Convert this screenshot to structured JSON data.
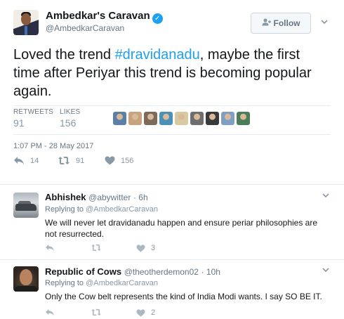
{
  "main_tweet": {
    "display_name": "Ambedkar's Caravan",
    "handle": "@AmbedkarCaravan",
    "follow_label": "Follow",
    "text_before": "Loved the trend ",
    "hashtag": "#dravidanadu",
    "text_after": ", maybe the first time after Periyar this trend is becoming popular again.",
    "retweets_label": "RETWEETS",
    "retweets_count": "91",
    "likes_label": "LIKES",
    "likes_count": "156",
    "timestamp": "1:07 PM - 28 May 2017",
    "actions": {
      "replies": "14",
      "retweets": "91",
      "likes": "156"
    },
    "liker_avatar_colors": [
      "#5b7fa6",
      "#c9a27e",
      "#7c6b5a",
      "#4a90b8",
      "#d8c9a0",
      "#6e6e6e",
      "#3a3a3a",
      "#7fa0c4",
      "#4c7d5a"
    ]
  },
  "replies": [
    {
      "display_name": "Abhishek",
      "handle": "@abywitter",
      "time": "· 6h",
      "replying_to_label": "Replying to",
      "replying_to": "@AmbedkarCaravan",
      "text": "We will never let dravidanadu happen and ensure periar philosophies are not resurrected.",
      "likes": "3"
    },
    {
      "display_name": "Republic of Cows",
      "handle": "@theotherdemon02",
      "time": "· 10h",
      "replying_to_label": "Replying to",
      "replying_to": "@AmbedkarCaravan",
      "text": "Only the Cow belt represents the kind of India Modi wants. I say SO BE IT.",
      "likes": "2"
    }
  ],
  "colors": {
    "accent": "#1da1f2",
    "text_primary": "#14171a",
    "text_secondary": "#657786",
    "action_gray": "#8899a6",
    "divider": "#e6ecf0"
  },
  "icons": [
    "verified-badge-icon",
    "add-user-icon",
    "chevron-down-icon",
    "reply-icon",
    "retweet-icon",
    "like-icon"
  ]
}
